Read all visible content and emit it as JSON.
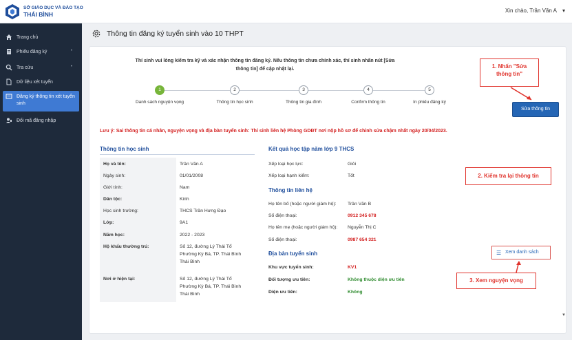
{
  "header": {
    "brand_line1": "SỞ GIÁO DỤC VÀ ĐÀO TẠO",
    "brand_line2": "THÁI BÌNH",
    "greeting": "Xin chào, Trần Văn A"
  },
  "sidebar": {
    "items": [
      {
        "label": "Trang chủ",
        "icon": "home-icon"
      },
      {
        "label": "Phiếu đăng ký",
        "icon": "document-icon"
      },
      {
        "label": "Tra cứu",
        "icon": "search-icon"
      },
      {
        "label": "Dữ liệu xét tuyển",
        "icon": "file-icon"
      },
      {
        "label": "Đăng ký thông tin xét tuyển sinh",
        "icon": "register-icon"
      },
      {
        "label": "Đổi mã đăng nhập",
        "icon": "user-key-icon"
      }
    ]
  },
  "page": {
    "title": "Thông tin đăng ký tuyển sinh vào 10 THPT",
    "intro": "Thí sinh vui lòng kiểm tra kỹ và xác nhận thông tin đăng ký. Nếu thông tin chưa chính xác, thí sinh nhấn nút [Sửa thông tin] để cập nhật lại.",
    "edit_button": "Sửa thông tin",
    "warning": "Lưu ý: Sai thông tin cá nhân, nguyện vọng và địa bàn tuyển sinh: Thí sinh liên hệ Phòng GDĐT nơi nộp hồ sơ để chỉnh sửa chậm nhất ngày 20/04/2023."
  },
  "steps": [
    {
      "num": "1",
      "label": "Danh sách nguyện vọng",
      "done": true
    },
    {
      "num": "2",
      "label": "Thông tin học sinh",
      "done": false
    },
    {
      "num": "3",
      "label": "Thông tin gia đình",
      "done": false
    },
    {
      "num": "4",
      "label": "Confirm thông tin",
      "done": false
    },
    {
      "num": "5",
      "label": "In phiếu đăng ký",
      "done": false
    }
  ],
  "student": {
    "title": "Thông tin học sinh",
    "fields": [
      {
        "label": "Họ và tên:",
        "value": "Trần Văn A"
      },
      {
        "label": "Ngày sinh:",
        "value": "01/01/2008"
      },
      {
        "label": "Giới tính:",
        "value": "Nam"
      },
      {
        "label": "Dân tộc:",
        "value": "Kinh"
      },
      {
        "label": "Học sinh trường:",
        "value": "THCS Trần Hưng Đạo"
      },
      {
        "label": "Lớp:",
        "value": "9A1"
      },
      {
        "label": "Năm học:",
        "value": "2022 - 2023"
      },
      {
        "label": "Hộ khẩu thường trú:",
        "value": "Số 12, đường Lý Thái Tổ"
      },
      {
        "label": "Nơi ở hiện tại:",
        "value": "Số 12, đường Lý Thái Tổ"
      }
    ],
    "address_line2": "Phường Kỳ Bá, TP. Thái Bình",
    "address_line3": "Thái Bình"
  },
  "results": {
    "title": "Kết quả học tập năm lớp 9 THCS",
    "fields": [
      {
        "label": "Xếp loại học lực:",
        "value": "Giỏi"
      },
      {
        "label": "Xếp loại hạnh kiểm:",
        "value": "Tốt"
      }
    ]
  },
  "contact": {
    "title": "Thông tin liên hệ",
    "fields": [
      {
        "label": "Họ tên bố (hoặc người giám hộ):",
        "value": "Trần Văn B"
      },
      {
        "label": "Số điện thoại:",
        "value": "0912 345 678"
      },
      {
        "label": "Họ tên mẹ (hoặc người giám hộ):",
        "value": "Nguyễn Thị C"
      },
      {
        "label": "Số điện thoại:",
        "value": "0987 654 321"
      }
    ]
  },
  "area": {
    "title": "Địa bàn tuyển sinh",
    "view_list": "Xem danh sách",
    "fields": [
      {
        "label": "Khu vực tuyển sinh:",
        "value": "KV1"
      },
      {
        "label": "Đối tượng ưu tiên:",
        "value": "Không thuộc diện ưu tiên"
      },
      {
        "label": "Diện ưu tiên:",
        "value": "Không"
      }
    ]
  },
  "annotations": {
    "a1_line1": "1. Nhấn \"Sửa",
    "a1_line2": "thông tin\"",
    "a2": "2. Kiểm tra lại thông tin",
    "a3": "3. Xem nguyện vọng"
  },
  "colors": {
    "accent": "#2566b5",
    "annotation": "#e0322b",
    "warning": "#d32020",
    "success": "#2e8b2e"
  }
}
